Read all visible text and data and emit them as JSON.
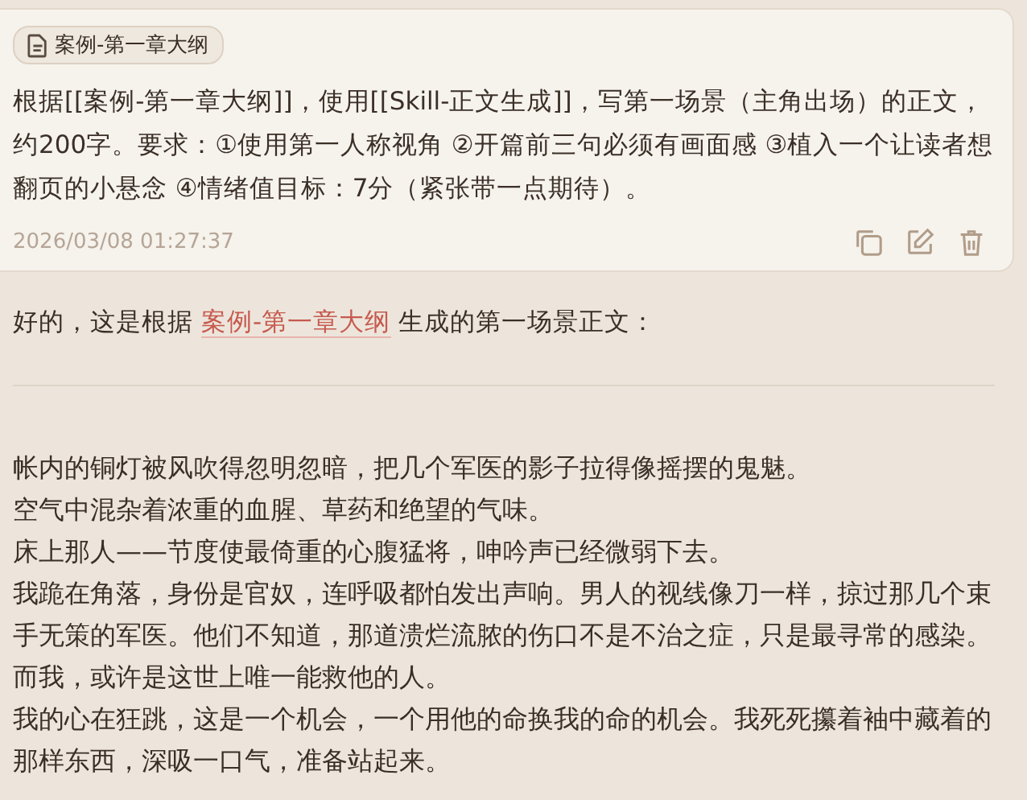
{
  "user_message": {
    "attachment": "案例-第一章大纲",
    "text": "根据[[案例-第一章大纲]]，使用[[Skill-正文生成]]，写第一场景（主角出场）的正文，约200字。要求：①使用第一人称视角 ②开篇前三句必须有画面感 ③植入一个让读者想翻页的小悬念 ④情绪值目标：7分（紧张带一点期待）。",
    "timestamp": "2026/03/08 01:27:37"
  },
  "reply": {
    "intro_before": "好的，这是根据",
    "link": "案例-第一章大纲",
    "intro_after": "生成的第一场景正文：",
    "paragraphs": [
      "帐内的铜灯被风吹得忽明忽暗，把几个军医的影子拉得像摇摆的鬼魅。",
      "空气中混杂着浓重的血腥、草药和绝望的气味。",
      "床上那人——节度使最倚重的心腹猛将，呻吟声已经微弱下去。",
      "我跪在角落，身份是官奴，连呼吸都怕发出声响。男人的视线像刀一样，掠过那几个束手无策的军医。他们不知道，那道溃烂流脓的伤口不是不治之症，只是最寻常的感染。",
      "而我，或许是这世上唯一能救他的人。",
      "我的心在狂跳，这是一个机会，一个用他的命换我的命的机会。我死死攥着袖中藏着的那样东西，深吸一口气，准备站起来。"
    ]
  }
}
